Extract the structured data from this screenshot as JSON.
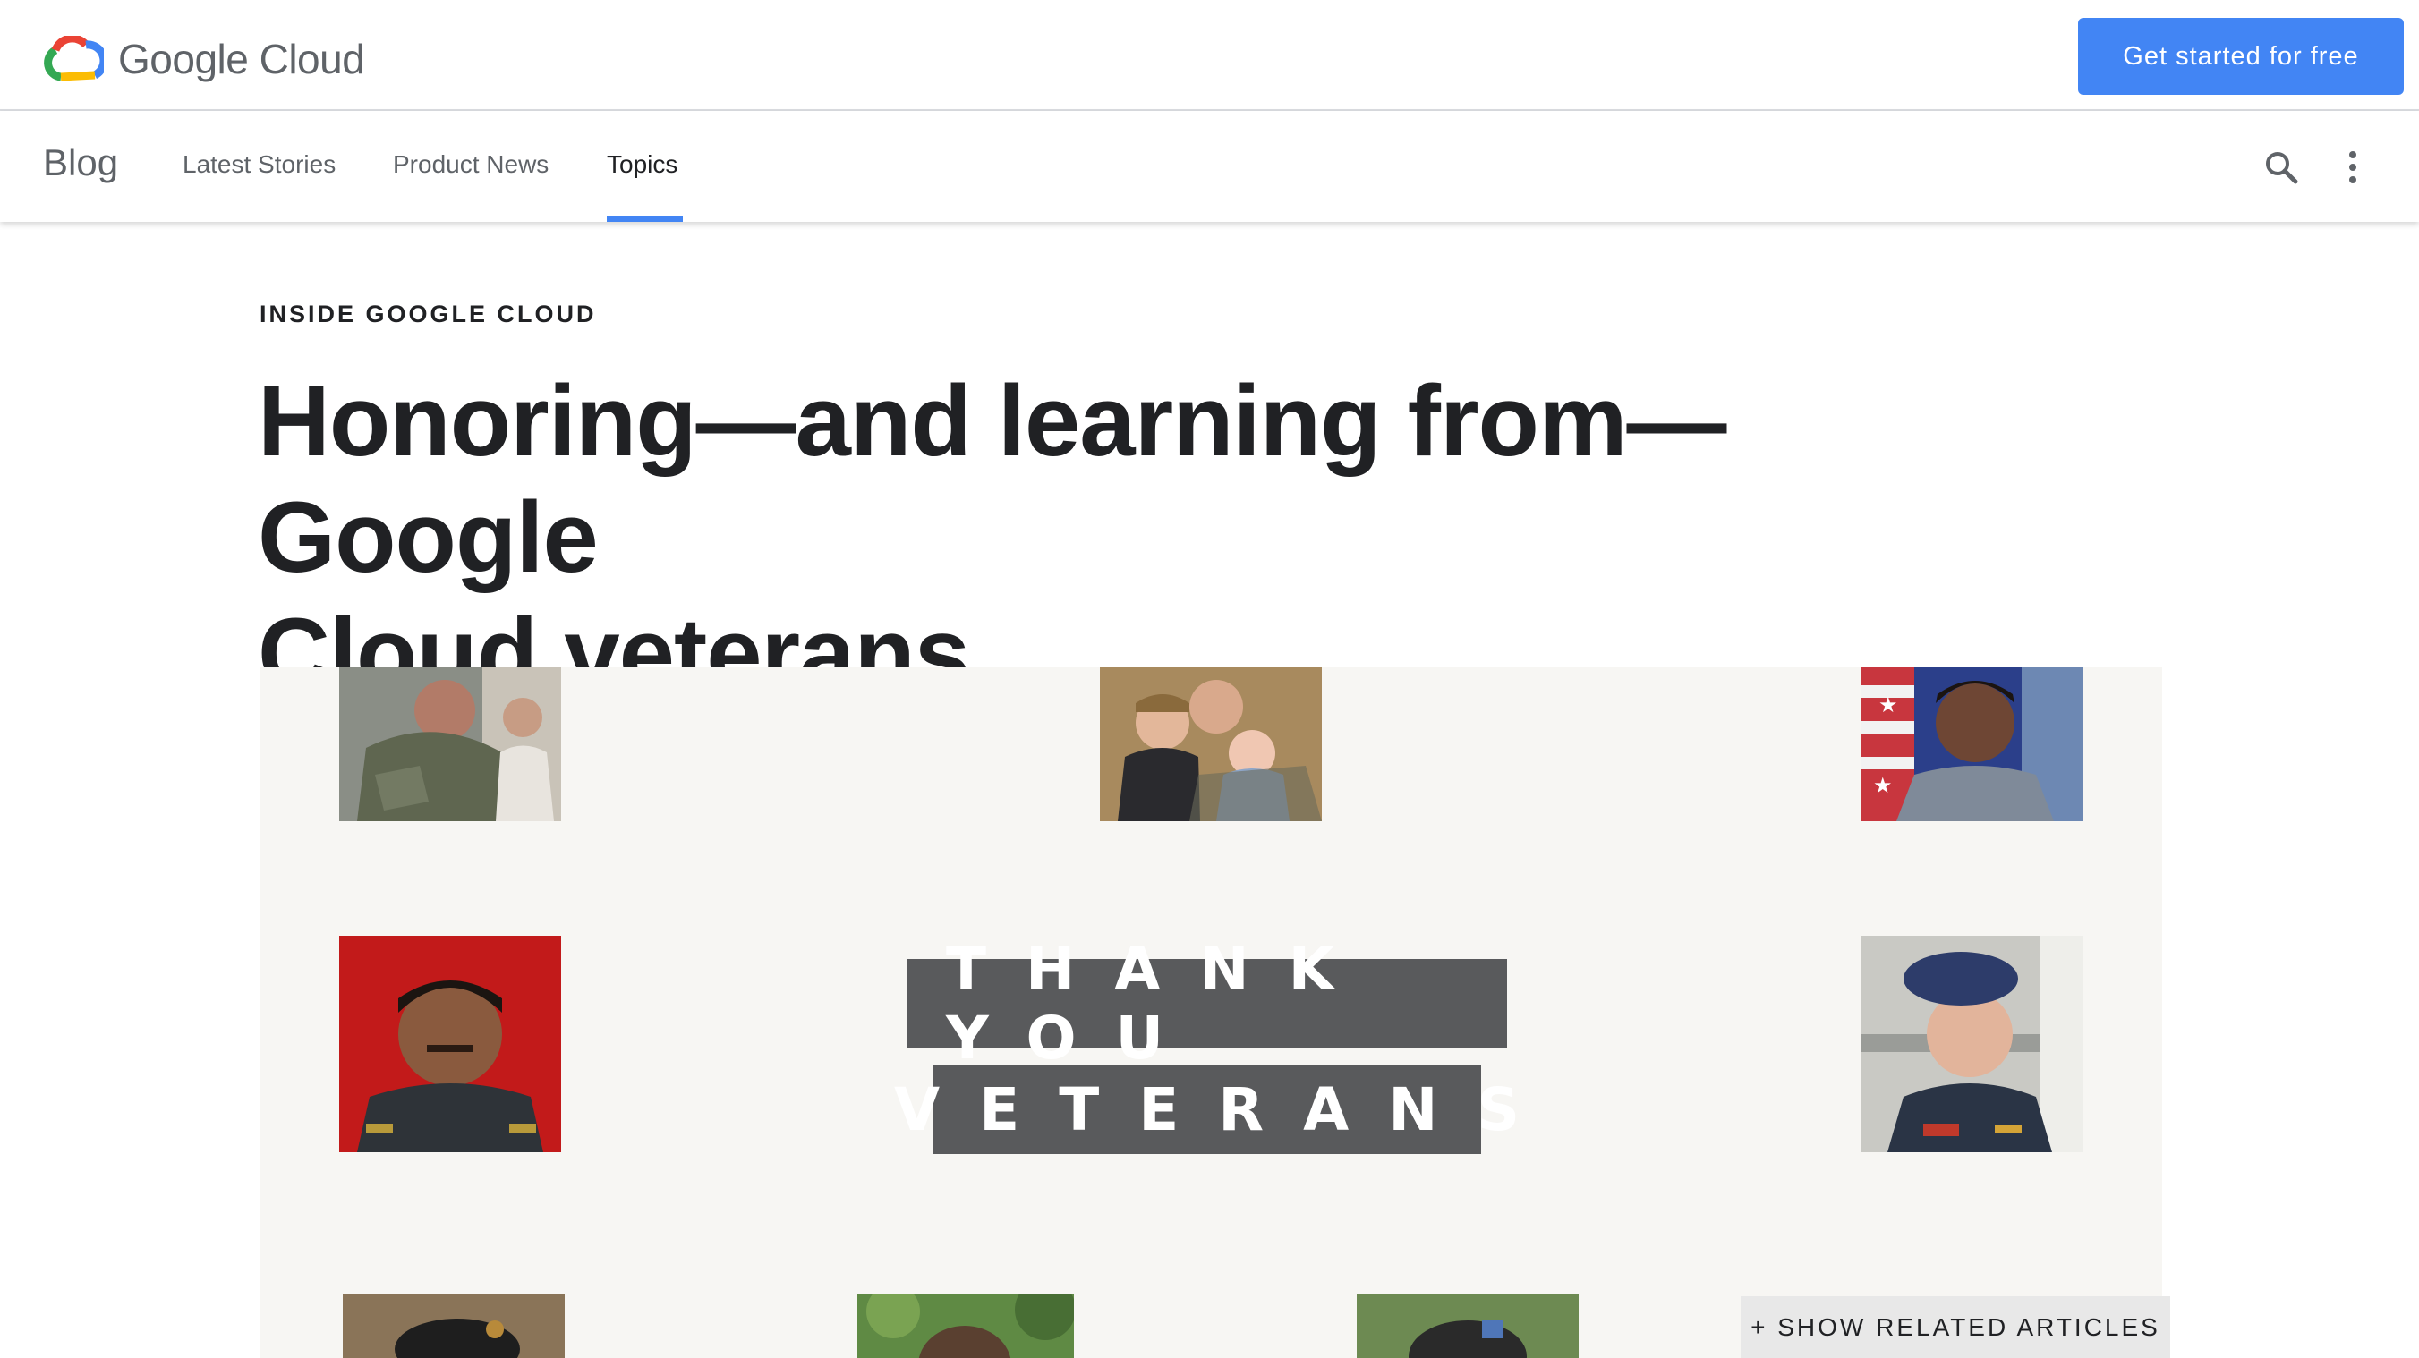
{
  "brand": {
    "name": "Google Cloud",
    "logo_icon": "google-cloud-logo-icon"
  },
  "header": {
    "cta_label": "Get started for free"
  },
  "nav": {
    "title": "Blog",
    "links": [
      "Latest Stories",
      "Product News",
      "Topics"
    ],
    "active": "Topics",
    "icons": [
      "search-icon",
      "more-vert-icon"
    ]
  },
  "article": {
    "eyebrow": "INSIDE GOOGLE CLOUD",
    "title_line1": "Honoring—and learning from—Google",
    "title_line2": "Cloud veterans",
    "hero": {
      "line1": "THANK YOU",
      "line2": "VETERANS",
      "photos": [
        "soldier-with-parent-photo",
        "veteran-with-children-photo",
        "airman-with-flag-photo",
        "officer-red-background-photo",
        "soldier-blue-beret-photo",
        "soldier-beret-photo",
        "veteran-outdoors-photo",
        "soldier-cap-photo"
      ]
    }
  },
  "related_button_label": "+ SHOW RELATED ARTICLES",
  "colors": {
    "accent": "#4285f4",
    "text": "#202124",
    "muted": "#5f6368",
    "banner": "#595a5c"
  }
}
